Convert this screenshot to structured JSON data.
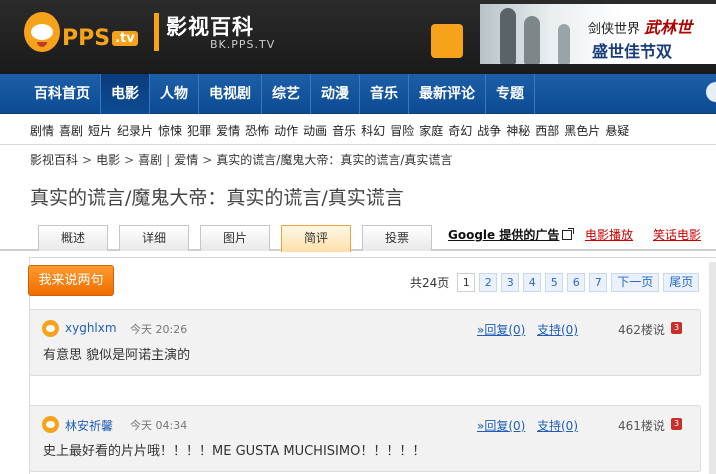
{
  "header": {
    "logo_text": "PPS",
    "logo_tv": ".tv",
    "site_title": "影视百科",
    "site_url": "BK.PPS.TV",
    "banner_line1_a": "剑侠世界",
    "banner_line1_b": "武林世",
    "banner_line2": "盛世佳节双"
  },
  "mainnav": {
    "items": [
      {
        "label": "百科首页"
      },
      {
        "label": "电影"
      },
      {
        "label": "人物"
      },
      {
        "label": "电视剧"
      },
      {
        "label": "综艺"
      },
      {
        "label": "动漫"
      },
      {
        "label": "音乐"
      },
      {
        "label": "最新评论"
      },
      {
        "label": "专题"
      }
    ],
    "active_index": 1
  },
  "subnav": {
    "items": [
      "剧情",
      "喜剧",
      "短片",
      "纪录片",
      "惊悚",
      "犯罪",
      "爱情",
      "恐怖",
      "动作",
      "动画",
      "音乐",
      "科幻",
      "冒险",
      "家庭",
      "奇幻",
      "战争",
      "神秘",
      "西部",
      "黑色片",
      "悬疑"
    ]
  },
  "breadcrumb": {
    "items": [
      "影视百科",
      "电影",
      "喜剧",
      "爱情",
      "真实的谎言/魔鬼大帝：真实的谎言/真实谎言"
    ]
  },
  "page_title": "真实的谎言/魔鬼大帝：真实的谎言/真实谎言",
  "tabs": [
    {
      "label": "概述"
    },
    {
      "label": "详细"
    },
    {
      "label": "图片"
    },
    {
      "label": "简评"
    },
    {
      "label": "投票"
    }
  ],
  "ads": {
    "google": "Google 提供的广告",
    "link1": "电影播放",
    "link2": "笑话电影"
  },
  "comments_area": {
    "say_button": "我来说两句",
    "total_pages": "共24页",
    "pages": [
      "1",
      "2",
      "3",
      "4",
      "5",
      "6",
      "7"
    ],
    "current_page": "1",
    "next": "下一页",
    "last": "尾页"
  },
  "comments": [
    {
      "user": "xyghlxm",
      "time": "今天 20:26",
      "reply": "»回复(0)",
      "support": "支持(0)",
      "floor": "462楼说",
      "text": "有意思 貌似是阿诺主演的"
    },
    {
      "user": "林安祈馨",
      "time": "今天 04:34",
      "reply": "»回复(0)",
      "support": "支持(0)",
      "floor": "461楼说",
      "text": "史上最好看的片片哦！！！！ME GUSTA MUCHISIMO！！！！！"
    }
  ],
  "colors": {
    "nav_blue": "#0d4b93",
    "brand_orange": "#f7a21b",
    "link_blue": "#1f5fb8"
  }
}
